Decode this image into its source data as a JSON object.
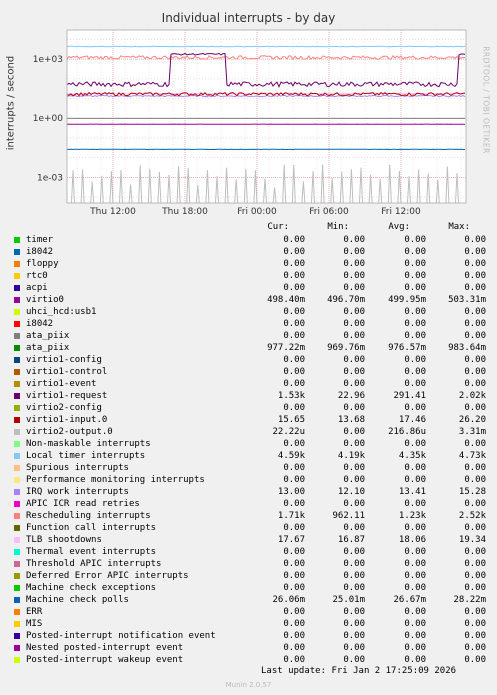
{
  "chart_data": {
    "type": "line",
    "title": "Individual interrupts - by day",
    "ylabel": "interrupts / second",
    "watermark": "RRDTOOL / TOBI OETIKER",
    "yscale": "log",
    "ylim": [
      5e-05,
      30000
    ],
    "y_ticks": [
      {
        "label": "1e+03",
        "value": 1000
      },
      {
        "label": "1e+00",
        "value": 1
      },
      {
        "label": "1e-03",
        "value": 0.001
      }
    ],
    "x_ticks": [
      "Thu 12:00",
      "Thu 18:00",
      "Fri 00:00",
      "Fri 06:00",
      "Fri 12:00"
    ],
    "grid": true,
    "columns": [
      "Cur:",
      "Min:",
      "Avg:",
      "Max:"
    ],
    "series": [
      {
        "name": "timer",
        "color": "#00cc00",
        "values": [
          "0.00",
          "0.00",
          "0.00",
          "0.00"
        ]
      },
      {
        "name": "i8042",
        "color": "#0066b3",
        "values": [
          "0.00",
          "0.00",
          "0.00",
          "0.00"
        ]
      },
      {
        "name": "floppy",
        "color": "#ff8000",
        "values": [
          "0.00",
          "0.00",
          "0.00",
          "0.00"
        ]
      },
      {
        "name": "rtc0",
        "color": "#ffcc00",
        "values": [
          "0.00",
          "0.00",
          "0.00",
          "0.00"
        ]
      },
      {
        "name": "acpi",
        "color": "#330099",
        "values": [
          "0.00",
          "0.00",
          "0.00",
          "0.00"
        ]
      },
      {
        "name": "virtio0",
        "color": "#990099",
        "values": [
          "498.40m",
          "496.70m",
          "499.95m",
          "503.31m"
        ]
      },
      {
        "name": "uhci_hcd:usb1",
        "color": "#ccff00",
        "values": [
          "0.00",
          "0.00",
          "0.00",
          "0.00"
        ]
      },
      {
        "name": "i8042",
        "color": "#ff0000",
        "values": [
          "0.00",
          "0.00",
          "0.00",
          "0.00"
        ]
      },
      {
        "name": "ata_piix",
        "color": "#808080",
        "values": [
          "0.00",
          "0.00",
          "0.00",
          "0.00"
        ]
      },
      {
        "name": "ata_piix",
        "color": "#008f00",
        "values": [
          "977.22m",
          "969.76m",
          "976.57m",
          "983.64m"
        ]
      },
      {
        "name": "virtio1-config",
        "color": "#00487d",
        "values": [
          "0.00",
          "0.00",
          "0.00",
          "0.00"
        ]
      },
      {
        "name": "virtio1-control",
        "color": "#b35a00",
        "values": [
          "0.00",
          "0.00",
          "0.00",
          "0.00"
        ]
      },
      {
        "name": "virtio1-event",
        "color": "#b38f00",
        "values": [
          "0.00",
          "0.00",
          "0.00",
          "0.00"
        ]
      },
      {
        "name": "virtio1-request",
        "color": "#6b006b",
        "values": [
          "1.53k",
          "22.96",
          "291.41",
          "2.02k"
        ]
      },
      {
        "name": "virtio2-config",
        "color": "#8fb300",
        "values": [
          "0.00",
          "0.00",
          "0.00",
          "0.00"
        ]
      },
      {
        "name": "virtio1-input.0",
        "color": "#b30000",
        "values": [
          "15.65",
          "13.68",
          "17.46",
          "26.20"
        ]
      },
      {
        "name": "virtio2-output.0",
        "color": "#bebebe",
        "values": [
          "22.22u",
          "0.00",
          "216.86u",
          "3.31m"
        ]
      },
      {
        "name": "Non-maskable interrupts",
        "color": "#80ff80",
        "values": [
          "0.00",
          "0.00",
          "0.00",
          "0.00"
        ]
      },
      {
        "name": "Local timer interrupts",
        "color": "#80c9ff",
        "values": [
          "4.59k",
          "4.19k",
          "4.35k",
          "4.73k"
        ]
      },
      {
        "name": "Spurious interrupts",
        "color": "#ffc080",
        "values": [
          "0.00",
          "0.00",
          "0.00",
          "0.00"
        ]
      },
      {
        "name": "Performance monitoring interrupts",
        "color": "#ffe680",
        "values": [
          "0.00",
          "0.00",
          "0.00",
          "0.00"
        ]
      },
      {
        "name": "IRQ work interrupts",
        "color": "#aa80ff",
        "values": [
          "13.00",
          "12.10",
          "13.41",
          "15.28"
        ]
      },
      {
        "name": "APIC ICR read retries",
        "color": "#ee00cc",
        "values": [
          "0.00",
          "0.00",
          "0.00",
          "0.00"
        ]
      },
      {
        "name": "Rescheduling interrupts",
        "color": "#ff8080",
        "values": [
          "1.71k",
          "962.11",
          "1.23k",
          "2.52k"
        ]
      },
      {
        "name": "Function call interrupts",
        "color": "#666600",
        "values": [
          "0.00",
          "0.00",
          "0.00",
          "0.00"
        ]
      },
      {
        "name": "TLB shootdowns",
        "color": "#ffbfff",
        "values": [
          "17.67",
          "16.87",
          "18.06",
          "19.34"
        ]
      },
      {
        "name": "Thermal event interrupts",
        "color": "#00ffcc",
        "values": [
          "0.00",
          "0.00",
          "0.00",
          "0.00"
        ]
      },
      {
        "name": "Threshold APIC interrupts",
        "color": "#cc6699",
        "values": [
          "0.00",
          "0.00",
          "0.00",
          "0.00"
        ]
      },
      {
        "name": "Deferred Error APIC interrupts",
        "color": "#999900",
        "values": [
          "0.00",
          "0.00",
          "0.00",
          "0.00"
        ]
      },
      {
        "name": "Machine check exceptions",
        "color": "#00cc00",
        "values": [
          "0.00",
          "0.00",
          "0.00",
          "0.00"
        ]
      },
      {
        "name": "Machine check polls",
        "color": "#0066b3",
        "values": [
          "26.06m",
          "25.01m",
          "26.67m",
          "28.22m"
        ]
      },
      {
        "name": "ERR",
        "color": "#ff8000",
        "values": [
          "0.00",
          "0.00",
          "0.00",
          "0.00"
        ]
      },
      {
        "name": "MIS",
        "color": "#ffcc00",
        "values": [
          "0.00",
          "0.00",
          "0.00",
          "0.00"
        ]
      },
      {
        "name": "Posted-interrupt notification event",
        "color": "#330099",
        "values": [
          "0.00",
          "0.00",
          "0.00",
          "0.00"
        ]
      },
      {
        "name": "Nested posted-interrupt event",
        "color": "#990099",
        "values": [
          "0.00",
          "0.00",
          "0.00",
          "0.00"
        ]
      },
      {
        "name": "Posted-interrupt wakeup event",
        "color": "#ccff00",
        "values": [
          "0.00",
          "0.00",
          "0.00",
          "0.00"
        ]
      }
    ]
  },
  "footer": {
    "last_update": "Last update: Fri Jan  2 17:25:09 2026",
    "version": "Munin 2.0.57"
  }
}
